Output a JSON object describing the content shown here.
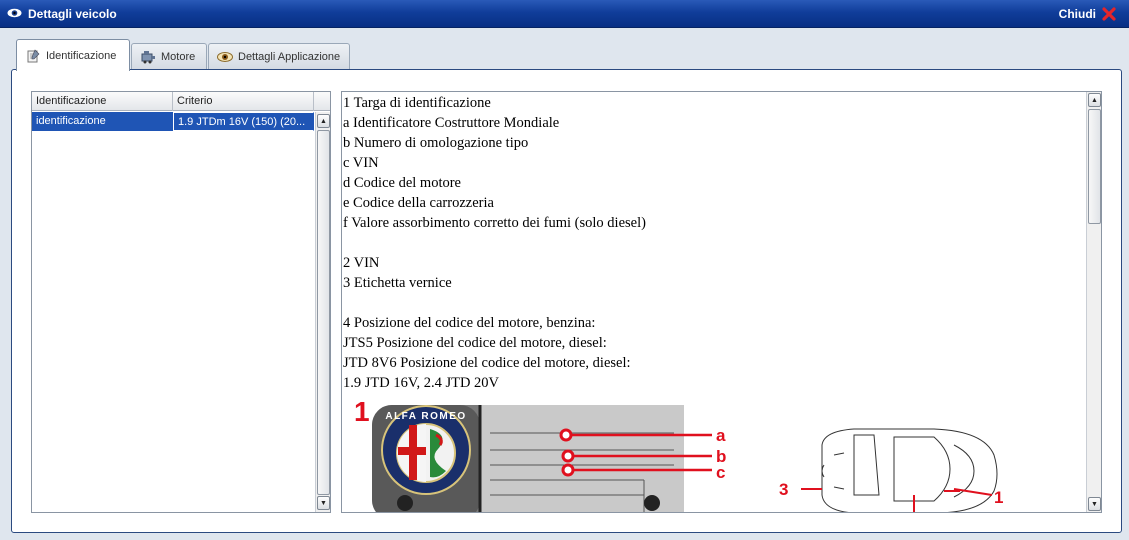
{
  "window": {
    "title": "Dettagli veicolo",
    "close_label": "Chiudi"
  },
  "tabs": [
    {
      "label": "Identificazione",
      "icon": "notepad-icon",
      "active": true
    },
    {
      "label": "Motore",
      "icon": "engine-icon",
      "active": false
    },
    {
      "label": "Dettagli Applicazione",
      "icon": "eye-icon",
      "active": false
    }
  ],
  "grid": {
    "columns": [
      "Identificazione",
      "Criterio"
    ],
    "rows": [
      {
        "identificazione": "identificazione",
        "criterio": "1.9 JTDm 16V (150) (20..."
      }
    ]
  },
  "document": {
    "lines": [
      "1 Targa di identificazione",
      "a Identificatore Costruttore Mondiale",
      "b Numero di omologazione tipo",
      "c VIN",
      "d Codice del motore",
      "e Codice della carrozzeria",
      "f Valore assorbimento corretto dei fumi (solo diesel)",
      "",
      "2 VIN",
      "3 Etichetta vernice",
      "",
      "4 Posizione del codice del motore, benzina:",
      "JTS5 Posizione del codice del motore, diesel:",
      "JTD 8V6 Posizione del codice del motore, diesel:",
      "1.9 JTD 16V, 2.4 JTD 20V"
    ],
    "figure": {
      "plate_number": "1",
      "logo_text": "ALFA ROMEO",
      "callouts": [
        "a",
        "b",
        "c"
      ],
      "car_labels": [
        "3",
        "1"
      ]
    }
  },
  "colors": {
    "titlebar": "#103d9a",
    "selection": "#1f55b5",
    "callout_red": "#e0101e"
  }
}
